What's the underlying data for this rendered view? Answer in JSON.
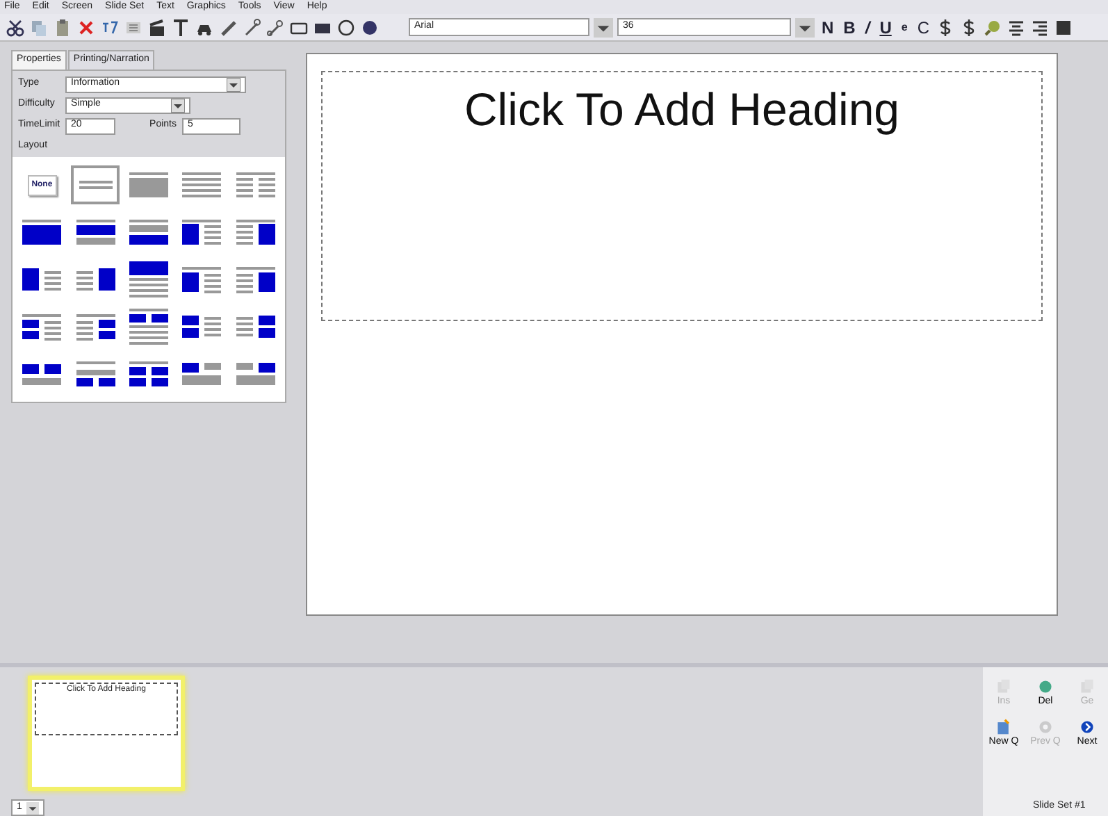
{
  "menu": [
    "File",
    "Edit",
    "Screen",
    "Slide Set",
    "Text",
    "Graphics",
    "Tools",
    "View",
    "Help"
  ],
  "toolbar": {
    "font": "Arial",
    "size": "36",
    "format": [
      {
        "text": "N",
        "kind": "bold"
      },
      {
        "text": "B",
        "kind": "bold"
      },
      {
        "text": "/",
        "kind": "italic"
      },
      {
        "text": "U",
        "kind": "underline"
      },
      {
        "text": "e",
        "kind": "small"
      },
      {
        "text": "C",
        "kind": "plain"
      }
    ]
  },
  "tabs": [
    {
      "label": "Properties",
      "selected": true
    },
    {
      "label": "Printing/Narration",
      "selected": false
    }
  ],
  "properties": {
    "type_label": "Type",
    "type": "Information",
    "difficulty_label": "Difficulty",
    "difficulty": "Simple",
    "timelimit_label": "TimeLimit",
    "timelimit": "20",
    "points_label": "Points",
    "points": "5",
    "layout_label": "Layout",
    "none_label": "None"
  },
  "layouts": [
    {
      "selected": false
    },
    {
      "selected": true
    },
    {
      "selected": false
    },
    {
      "selected": false
    },
    {
      "selected": false
    },
    {
      "selected": false
    },
    {
      "selected": false
    },
    {
      "selected": false
    },
    {
      "selected": false
    },
    {
      "selected": false
    },
    {
      "selected": false
    },
    {
      "selected": false
    },
    {
      "selected": false
    },
    {
      "selected": false
    },
    {
      "selected": false
    },
    {
      "selected": false
    },
    {
      "selected": false
    },
    {
      "selected": false
    },
    {
      "selected": false
    },
    {
      "selected": false
    },
    {
      "selected": false
    },
    {
      "selected": false
    },
    {
      "selected": false
    },
    {
      "selected": false
    },
    {
      "selected": false
    }
  ],
  "slide": {
    "heading": "Click To Add Heading"
  },
  "thumbnails": [
    {
      "heading": "Click To Add Heading",
      "selected": true
    }
  ],
  "page_select": "1",
  "actions": [
    {
      "label": "Ins",
      "disabled": true
    },
    {
      "label": "Del",
      "disabled": false
    },
    {
      "label": "Ge",
      "disabled": true
    },
    {
      "label": "New Q",
      "disabled": false
    },
    {
      "label": "Prev Q",
      "disabled": true
    },
    {
      "label": "Next",
      "disabled": false
    }
  ],
  "status": "Slide Set #1"
}
